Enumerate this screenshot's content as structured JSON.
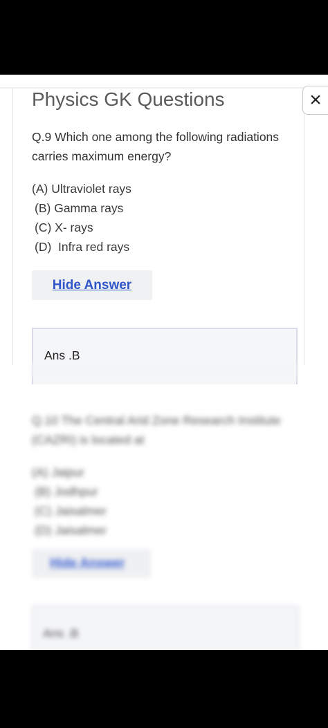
{
  "app_title": "Physics GK Questions",
  "close_label": "×",
  "question": {
    "number": "Q.9",
    "text": "Which one among the following radiations carries maximum energy?"
  },
  "options": [
    {
      "letter": "(A)",
      "text": "Ultraviolet rays"
    },
    {
      "letter": "(B)",
      "text": "Gamma rays"
    },
    {
      "letter": "(C)",
      "text": "X- rays"
    },
    {
      "letter": "(D)",
      "text": "Infra red rays"
    }
  ],
  "hide_answer_label": "Hide Answer",
  "answer_text": "Ans .B",
  "blurred_next": {
    "question_line1": "Q.10 The Central Arid Zone Research Institute",
    "question_line2": "(CAZRI) is located at",
    "options": [
      "(A)  Jaipur",
      "(B)  Jodhpur",
      "(C)  Jaisalmer",
      "(D)  Jaisalmer"
    ],
    "hide_answer_label": "Hide Answer",
    "answer_text": "Ans .B"
  }
}
